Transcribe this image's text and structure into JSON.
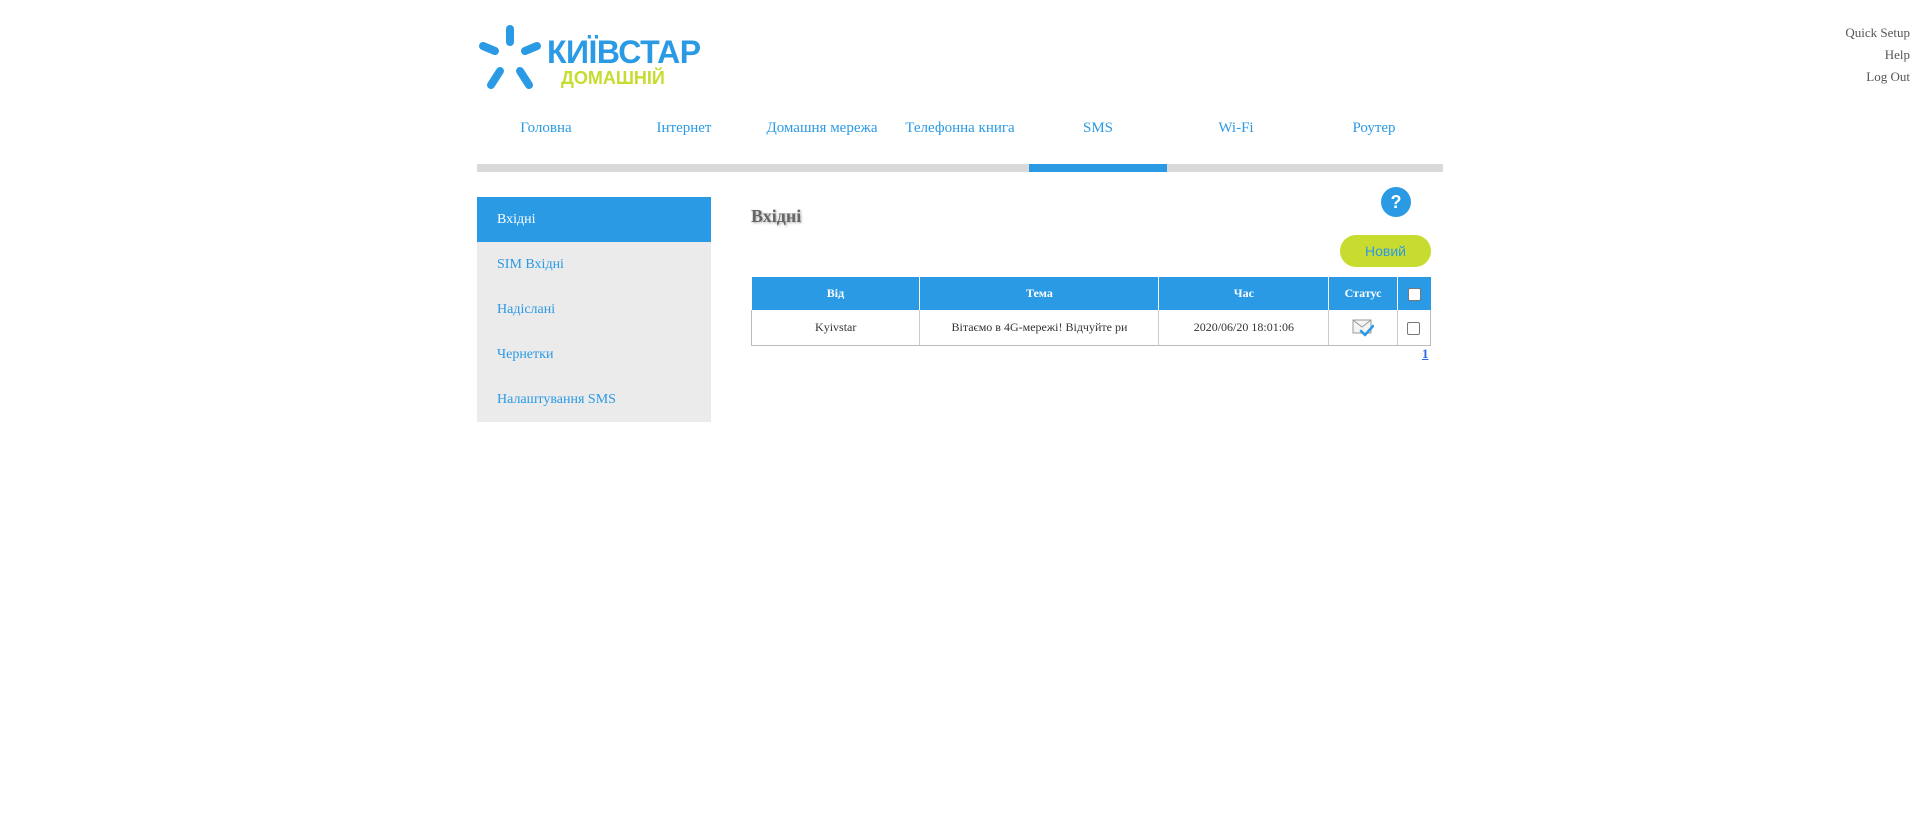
{
  "header": {
    "brand_name": "КИЇВСТАР",
    "brand_sub": "ДОМАШНІЙ",
    "top_links": [
      "Quick Setup",
      "Help",
      "Log Out"
    ]
  },
  "nav": {
    "tabs": [
      "Головна",
      "Інтернет",
      "Домашня мережа",
      "Телефонна книга",
      "SMS",
      "Wi-Fi",
      "Роутер"
    ],
    "active": "SMS"
  },
  "sidebar": {
    "items": [
      "Вхідні",
      "SIM Вхідні",
      "Надіслані",
      "Чернетки",
      "Налаштування SMS"
    ],
    "active": "Вхідні"
  },
  "main": {
    "title": "Вхідні",
    "help_label": "?",
    "new_button": "Новий",
    "table": {
      "columns": [
        "Від",
        "Тема",
        "Час",
        "Статус"
      ],
      "rows": [
        {
          "from": "Kyivstar",
          "subject": "Вітаємо в 4G-мережі! Відчуйте ри",
          "time": "2020/06/20 18:01:06",
          "status_icon": "read-envelope-check-icon",
          "selected": false
        }
      ]
    },
    "pagination": {
      "current": "1"
    }
  },
  "colors": {
    "accent": "#2a9ae5",
    "lime": "#c7dc2f",
    "sidebar_bg": "#ebebeb",
    "nav_track": "#d9d9d9"
  }
}
